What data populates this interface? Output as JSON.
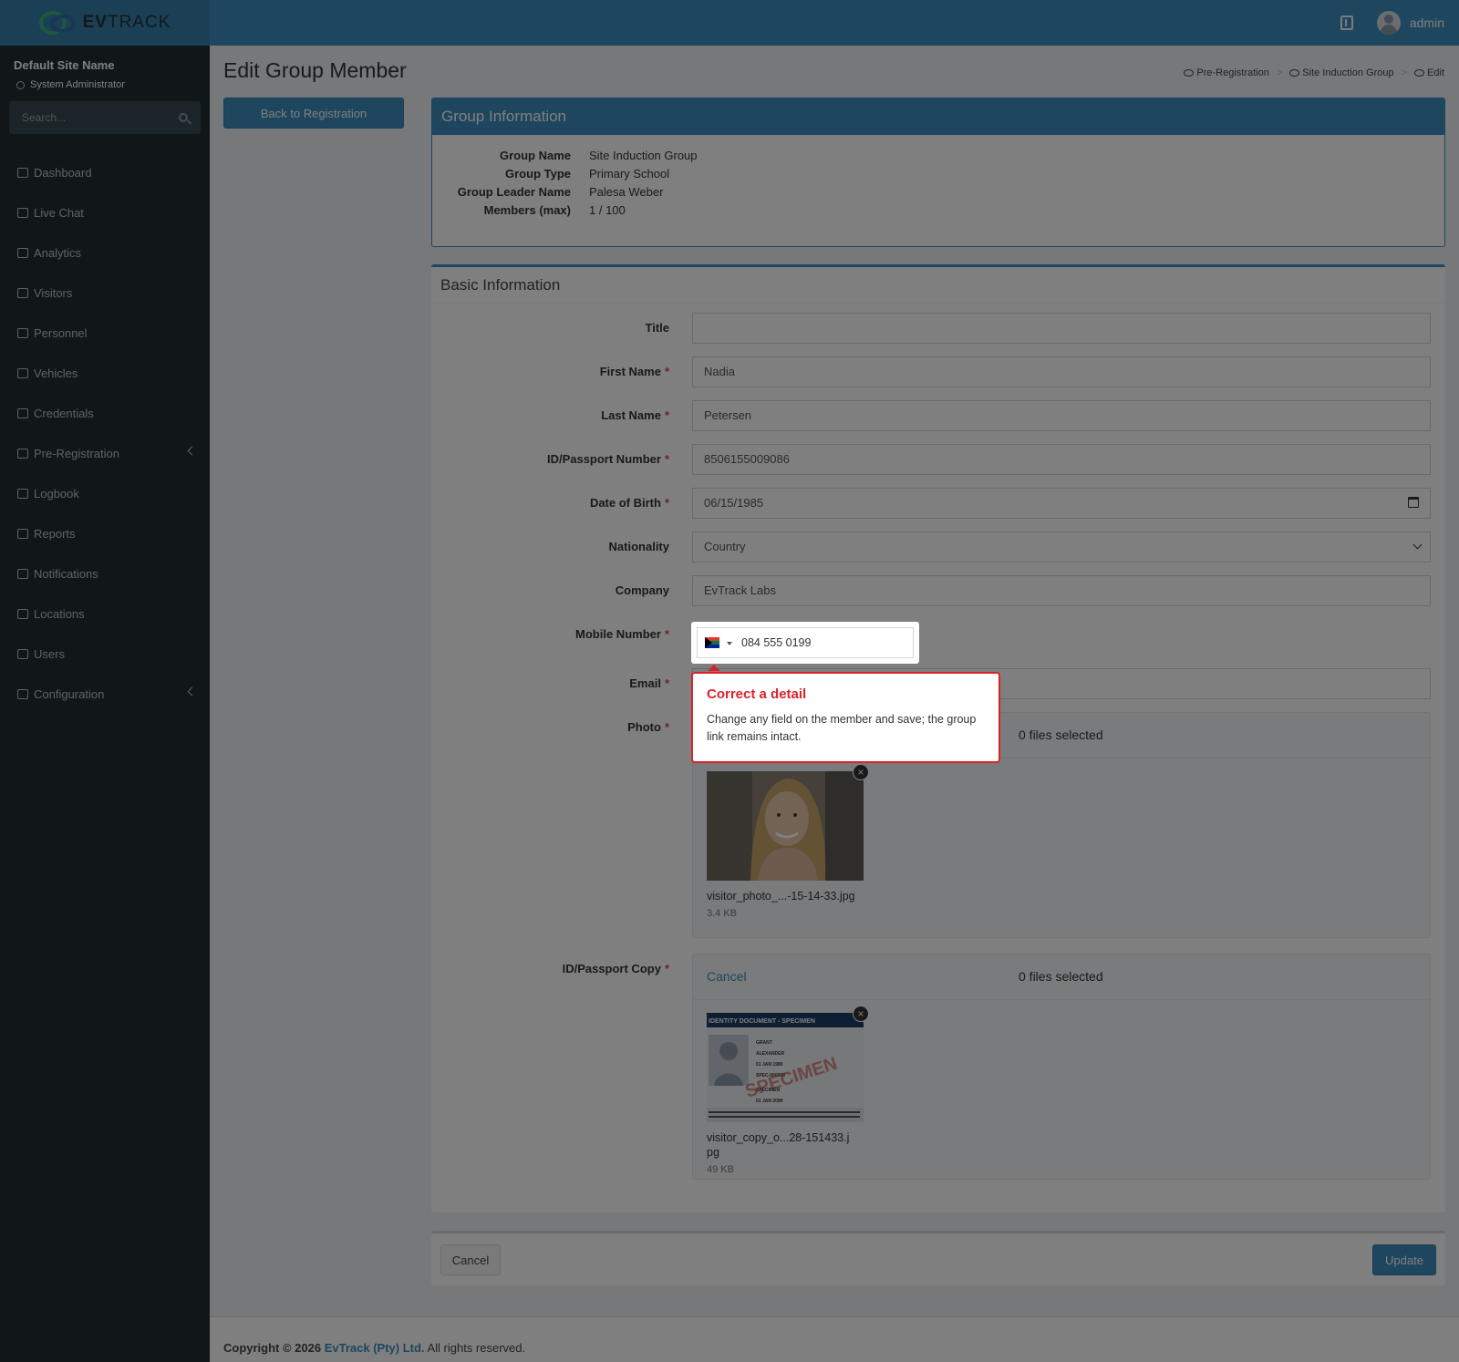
{
  "brand": {
    "name_bold": "EV",
    "name_rest": "TRACK"
  },
  "topbar": {
    "user_name": "admin"
  },
  "sidebar": {
    "site_name": "Default Site Name",
    "role": "System Administrator",
    "search_placeholder": "Search...",
    "items": [
      {
        "label": "Dashboard",
        "icon": "dashboard-icon"
      },
      {
        "label": "Live Chat",
        "icon": "headset-icon"
      },
      {
        "label": "Analytics",
        "icon": "analytics-icon"
      },
      {
        "label": "Visitors",
        "icon": "eye-icon"
      },
      {
        "label": "Personnel",
        "icon": "person-icon"
      },
      {
        "label": "Vehicles",
        "icon": "car-icon"
      },
      {
        "label": "Credentials",
        "icon": "id-card-icon"
      },
      {
        "label": "Pre-Registration",
        "icon": "exchange-icon",
        "expandable": true
      },
      {
        "label": "Logbook",
        "icon": "book-icon"
      },
      {
        "label": "Reports",
        "icon": "chart-icon"
      },
      {
        "label": "Notifications",
        "icon": "message-icon"
      },
      {
        "label": "Locations",
        "icon": "map-icon"
      },
      {
        "label": "Users",
        "icon": "users-icon"
      },
      {
        "label": "Configuration",
        "icon": "gear-icon",
        "expandable": true
      }
    ]
  },
  "page": {
    "title": "Edit Group Member",
    "back_button": "Back to Registration",
    "breadcrumb": [
      "Pre-Registration",
      "Site Induction Group",
      "Edit"
    ]
  },
  "group_info": {
    "header": "Group Information",
    "rows": [
      {
        "label": "Group Name",
        "value": "Site Induction Group"
      },
      {
        "label": "Group Type",
        "value": "Primary School"
      },
      {
        "label": "Group Leader Name",
        "value": "Palesa Weber"
      },
      {
        "label": "Members (max)",
        "value": "1 / 100"
      }
    ]
  },
  "basic_info": {
    "header": "Basic Information",
    "fields": {
      "title": {
        "label": "Title",
        "value": ""
      },
      "first_name": {
        "label": "First Name",
        "value": "Nadia"
      },
      "last_name": {
        "label": "Last Name",
        "value": "Petersen"
      },
      "id_number": {
        "label": "ID/Passport Number",
        "value": "8506155009086"
      },
      "dob": {
        "label": "Date of Birth",
        "value": "06/15/1985"
      },
      "nationality": {
        "label": "Nationality",
        "value": "Country"
      },
      "company": {
        "label": "Company",
        "value": "EvTrack Labs"
      },
      "mobile": {
        "label": "Mobile Number",
        "value": "084 555 0199"
      },
      "email": {
        "label": "Email",
        "value": ""
      },
      "photo": {
        "label": "Photo",
        "count": "0 files selected",
        "file_name": "visitor_photo_...-15-14-33.jpg",
        "file_size": "3.4 KB"
      },
      "id_copy": {
        "label": "ID/Passport Copy",
        "cancel": "Cancel",
        "count": "0 files selected",
        "file_name": "visitor_copy_o...28-151433.jpg",
        "file_size": "49 KB"
      }
    },
    "required_mark": "*"
  },
  "id_card": {
    "header": "IDENTITY DOCUMENT - SPECIMEN",
    "watermark": "SPECIMEN",
    "surname": "GRANT",
    "given": "ALEXANDER",
    "dob": "01 JAN 1980",
    "number": "SPEC-000000",
    "nat": "SPECIMEN",
    "exp": "01 JAN 2099"
  },
  "actions": {
    "cancel": "Cancel",
    "update": "Update"
  },
  "footer": {
    "prefix": "Copyright © 2026",
    "company": "EvTrack (Pty) Ltd.",
    "suffix": "All rights reserved."
  },
  "tooltip": {
    "title": "Correct a detail",
    "body": "Change any field on the member and save; the group link remains intact."
  },
  "colors": {
    "primary": "#3c8dbc",
    "sidebar": "#222d32",
    "tooltip_accent": "#d9232a"
  }
}
